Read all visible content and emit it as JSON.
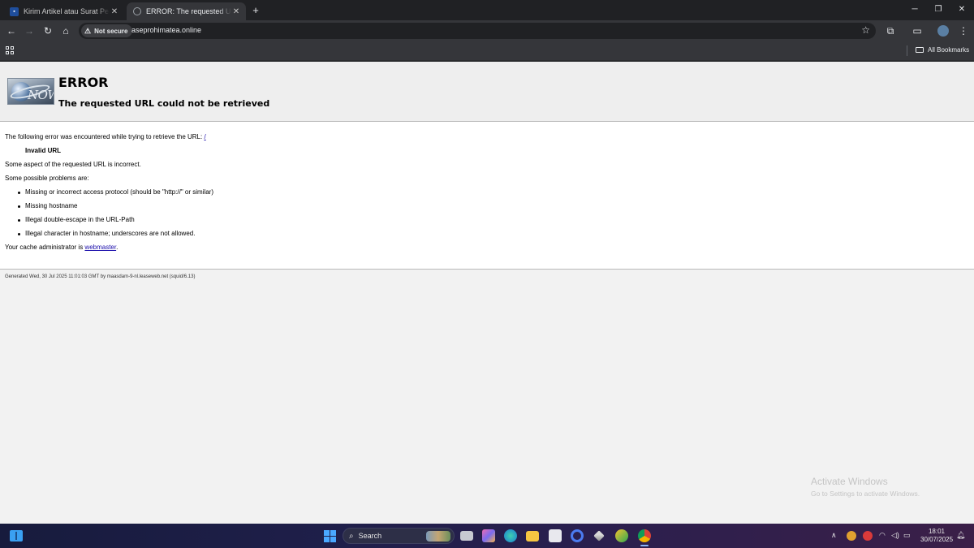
{
  "browser": {
    "tabs": [
      {
        "title": "Kirim Artikel atau Surat Pembaca",
        "active": false
      },
      {
        "title": "ERROR: The requested URL could not be retrieved",
        "active": true
      }
    ],
    "security_label": "Not secure",
    "url": "aseprohimatea.online",
    "bookmarks_label": "All Bookmarks"
  },
  "page": {
    "logo_text": "NOW",
    "heading": "ERROR",
    "subheading": "The requested URL could not be retrieved",
    "intro": "The following error was encountered while trying to retrieve the URL: ",
    "intro_link": "/",
    "error_name": "Invalid URL",
    "aspect": "Some aspect of the requested URL is incorrect.",
    "problems_label": "Some possible problems are:",
    "problems": [
      "Missing or incorrect access protocol (should be \"http://\" or similar)",
      "Missing hostname",
      "Illegal double-escape in the URL-Path",
      "Illegal character in hostname; underscores are not allowed."
    ],
    "admin_prefix": "Your cache administrator is ",
    "admin_link": "webmaster",
    "admin_suffix": ".",
    "footer": "Generated Wed, 30 Jul 2025 11:01:03 GMT by maasdam-9-nl.leaseweb.net (squid/6.13)"
  },
  "watermark": {
    "line1": "Activate Windows",
    "line2": "Go to Settings to activate Windows."
  },
  "taskbar": {
    "search_placeholder": "Search",
    "time": "18:01",
    "date": "30/07/2025"
  }
}
